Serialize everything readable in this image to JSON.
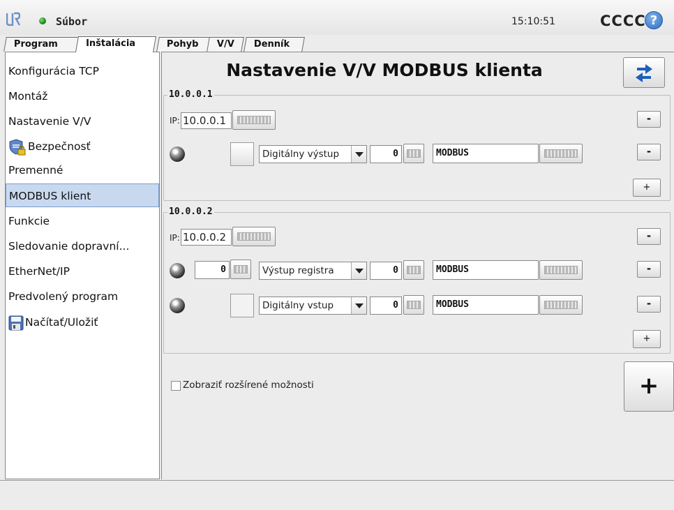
{
  "topbar": {
    "file_menu": "Súbor",
    "clock": "15:10:51",
    "robot_name": "CCCC",
    "help": "?"
  },
  "tabs": [
    {
      "label": "Program"
    },
    {
      "label": "Inštalácia"
    },
    {
      "label": "Pohyb"
    },
    {
      "label": "V/V"
    },
    {
      "label": "Denník"
    }
  ],
  "sidebar": {
    "items": [
      {
        "label": "Konfigurácia TCP"
      },
      {
        "label": "Montáž"
      },
      {
        "label": "Nastavenie V/V"
      },
      {
        "label": "Bezpečnosť"
      },
      {
        "label": "Premenné"
      },
      {
        "label": "MODBUS klient"
      },
      {
        "label": "Funkcie"
      },
      {
        "label": "Sledovanie dopravní..."
      },
      {
        "label": "EtherNet/IP"
      },
      {
        "label": "Predvolený program"
      },
      {
        "label": "Načítať/Uložiť"
      }
    ],
    "selected": "MODBUS klient"
  },
  "main": {
    "title": "Nastavenie V/V MODBUS klienta",
    "ip_prefix": "IP:",
    "units": [
      {
        "header": "10.0.0.1",
        "ip": "10.0.0.1",
        "signals": [
          {
            "address": "",
            "type": "Digitálny výstup",
            "register": "0",
            "name": "MODBUS"
          }
        ]
      },
      {
        "header": "10.0.0.2",
        "ip": "10.0.0.2",
        "signals": [
          {
            "address": "0",
            "type": "Výstup registra",
            "register": "0",
            "name": "MODBUS"
          },
          {
            "address": "",
            "type": "Digitálny vstup",
            "register": "0",
            "name": "MODBUS"
          }
        ]
      }
    ],
    "remove_label": "-",
    "add_signal_label": "+",
    "add_unit_label": "+",
    "advanced_label": "Zobraziť rozšírené možnosti",
    "advanced_checked": false
  },
  "colors": {
    "selected_bg": "#c8d9ef",
    "help_blue": "#2e6cc0",
    "refresh_blue": "#1e5fb8"
  }
}
